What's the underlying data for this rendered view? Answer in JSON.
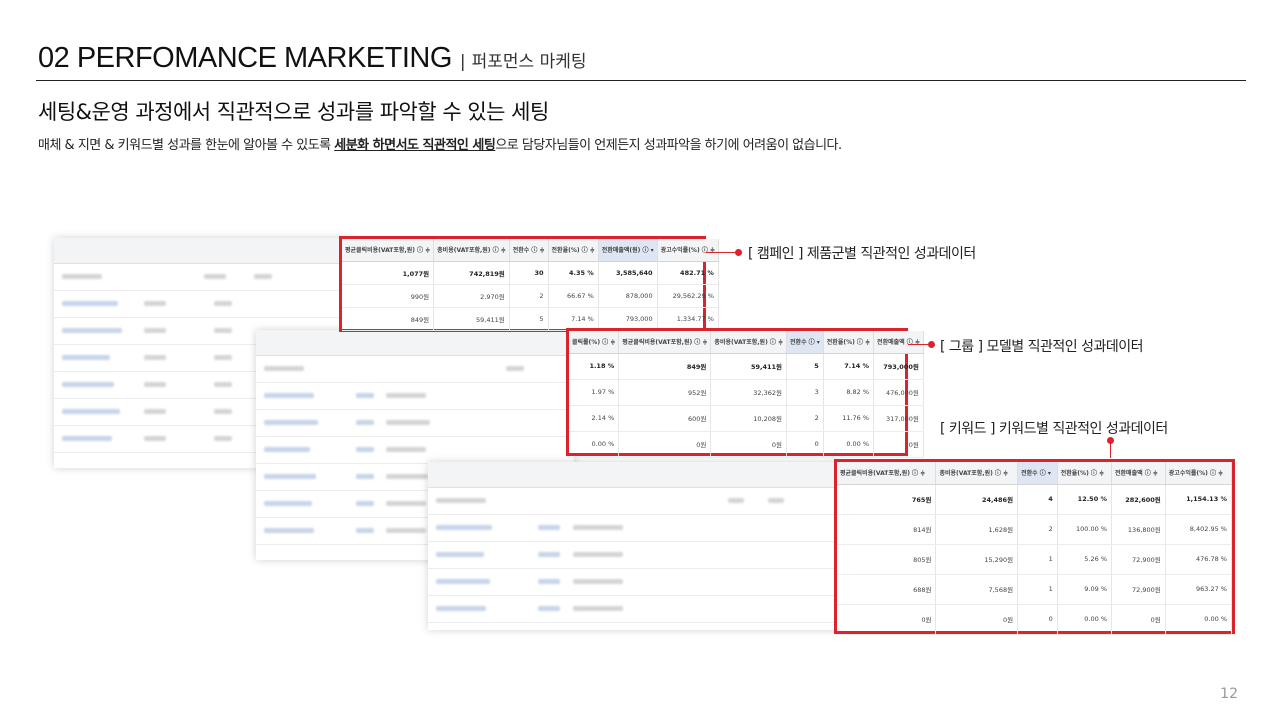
{
  "header": {
    "title": "02 PERFOMANCE  MARKETING",
    "separator": "|",
    "subtitle": "퍼포먼스 마케팅"
  },
  "headline": "세팅&운영 과정에서 직관적으로 성과를 파악할 수 있는 세팅",
  "description": {
    "before": "매체 & 지면 & 키워드별 성과를 한눈에 알아볼 수 있도록 ",
    "emphasis": "세분화 하면서도 직관적인 세팅",
    "after": "으로 담당자님들이 언제든지 성과파악을 하기에 어려움이 없습니다."
  },
  "page_number": "12",
  "colors": {
    "accent": "#d9232d",
    "header_bg": "#f3f4f6",
    "sorted_header_bg": "#dde6f2"
  },
  "callouts": {
    "campaign": "[ 캠페인 ] 제품군별 직관적인 성과데이터",
    "group": "[ 그룹 ] 모델별 직관적인 성과데이터",
    "keyword": "[ 키워드 ] 키워드별 직관적인 성과데이터"
  },
  "tables": {
    "campaign": {
      "columns": [
        "평균클릭비용(VAT포함,원) ⓘ ≑",
        "총비용(VAT포함,원) ⓘ ≑",
        "전환수 ⓘ ≑",
        "전환율(%) ⓘ ≑",
        "전환매출액(원) ⓘ ▾",
        "광고수익률(%) ⓘ ≑"
      ],
      "rows": [
        [
          "1,077원",
          "742,819원",
          "30",
          "4.35 %",
          "3,585,640",
          "482.71 %"
        ],
        [
          "990원",
          "2,970원",
          "2",
          "66.67 %",
          "878,000",
          "29,562.29 %"
        ],
        [
          "849원",
          "59,411원",
          "5",
          "7.14 %",
          "793,000",
          "1,334.77 %"
        ]
      ]
    },
    "group": {
      "columns": [
        "클릭률(%) ⓘ ≑",
        "평균클릭비용(VAT포함,원) ⓘ ≑",
        "총비용(VAT포함,원) ⓘ ≑",
        "전환수 ⓘ ▾",
        "전환율(%) ⓘ ≑",
        "전환매출액 ⓘ ≑"
      ],
      "rows": [
        [
          "1.18 %",
          "849원",
          "59,411원",
          "5",
          "7.14 %",
          "793,000원"
        ],
        [
          "1.97 %",
          "952원",
          "32,362원",
          "3",
          "8.82 %",
          "476,000원"
        ],
        [
          "2.14 %",
          "600원",
          "10,208원",
          "2",
          "11.76 %",
          "317,000원"
        ],
        [
          "0.00 %",
          "0원",
          "0원",
          "0",
          "0.00 %",
          "0원"
        ]
      ]
    },
    "keyword": {
      "columns": [
        "평균클릭비용(VAT포함,원) ⓘ ≑",
        "총비용(VAT포함,원) ⓘ ≑",
        "전환수 ⓘ ▾",
        "전환율(%) ⓘ ≑",
        "전환매출액 ⓘ ≑",
        "광고수익률(%) ⓘ ≑"
      ],
      "rows": [
        [
          "765원",
          "24,486원",
          "4",
          "12.50 %",
          "282,600원",
          "1,154.13 %"
        ],
        [
          "814원",
          "1,628원",
          "2",
          "100.00 %",
          "136,800원",
          "8,402.95 %"
        ],
        [
          "805원",
          "15,290원",
          "1",
          "5.26 %",
          "72,900원",
          "476.78 %"
        ],
        [
          "688원",
          "7,568원",
          "1",
          "9.09 %",
          "72,900원",
          "963.27 %"
        ],
        [
          "0원",
          "0원",
          "0",
          "0.00 %",
          "0원",
          "0.00 %"
        ]
      ]
    }
  }
}
